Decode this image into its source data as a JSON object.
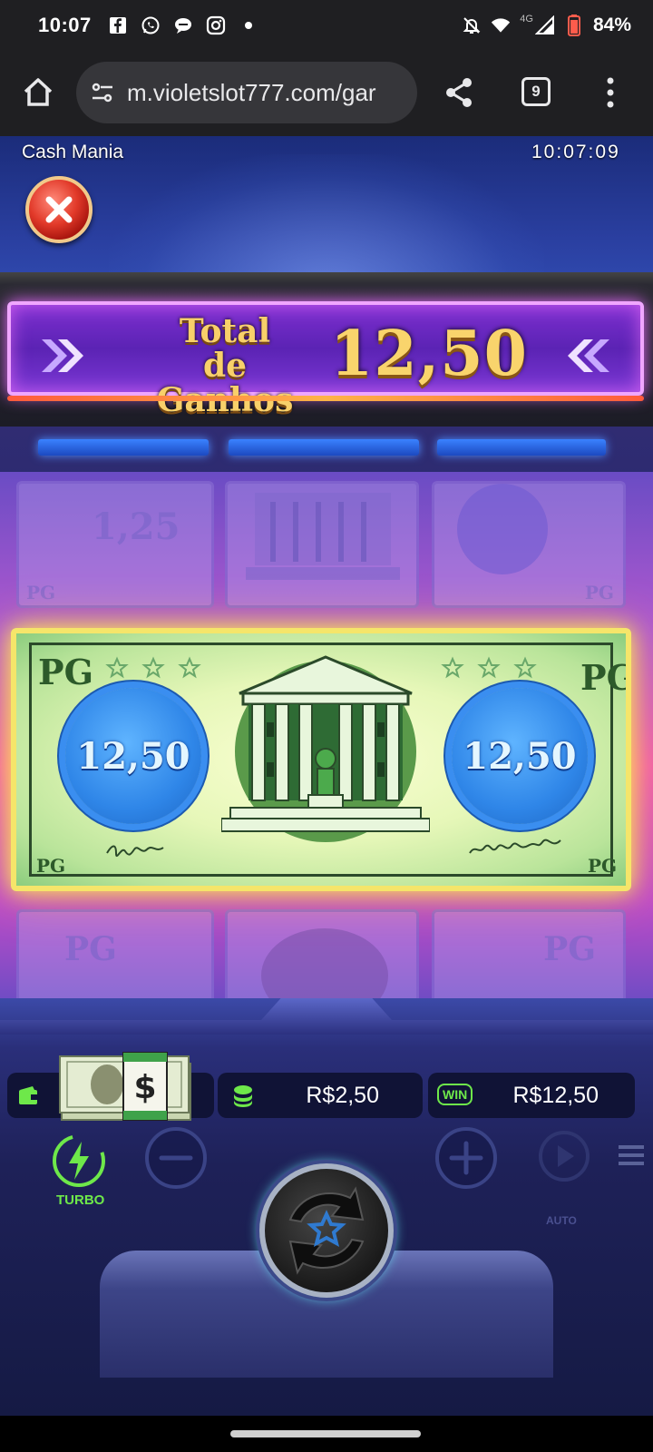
{
  "status_bar": {
    "time": "10:07",
    "battery": "84%",
    "network": "4G",
    "left_icons": [
      "facebook-icon",
      "whatsapp-icon",
      "chat-bubble-icon",
      "instagram-icon",
      "dot-icon"
    ],
    "right_icons": [
      "silent-bell-icon",
      "wifi-icon",
      "signal-icon",
      "battery-icon"
    ]
  },
  "browser": {
    "url": "m.violetslot777.com/gar",
    "tab_count": "9"
  },
  "game": {
    "title": "Cash Mania",
    "clock": "10:07:09",
    "banner_label": "Total de Ganhos",
    "banner_value": "12,50",
    "reel_upper_left_value": "1,25",
    "note_value_left": "12,50",
    "note_value_right": "12,50",
    "pg_mark": "PG"
  },
  "panel": {
    "bet_value": "R$2,50",
    "win_label": "WIN",
    "win_value": "R$12,50",
    "turbo_label": "TURBO",
    "auto_label": "AUTO"
  },
  "colors": {
    "banner_gold": "#f9d46c",
    "turbo_green": "#6ee84a",
    "note_border": "#f5e56a",
    "badge_blue": "#2f86e8"
  }
}
